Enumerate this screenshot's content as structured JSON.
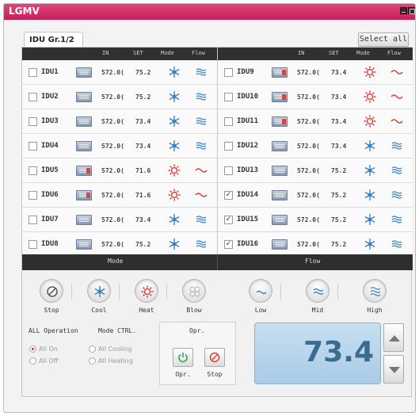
{
  "window": {
    "title": "LGMV"
  },
  "group_tab": "IDU Gr.1/2",
  "select_all": "Select all",
  "table_headers": [
    "IN",
    "SET",
    "Mode",
    "Flow"
  ],
  "left_rows": [
    {
      "name": "IDU1",
      "checked": false,
      "in": "572.0(",
      "set": "75.2",
      "mode": "cool",
      "flow": "wind",
      "unit": "cool"
    },
    {
      "name": "IDU2",
      "checked": false,
      "in": "572.0(",
      "set": "75.2",
      "mode": "cool",
      "flow": "wind",
      "unit": "cool"
    },
    {
      "name": "IDU3",
      "checked": false,
      "in": "572.0(",
      "set": "73.4",
      "mode": "cool",
      "flow": "wind",
      "unit": "cool"
    },
    {
      "name": "IDU4",
      "checked": false,
      "in": "572.0(",
      "set": "73.4",
      "mode": "cool",
      "flow": "wind",
      "unit": "cool"
    },
    {
      "name": "IDU5",
      "checked": false,
      "in": "572.0(",
      "set": "71.6",
      "mode": "heat",
      "flow": "wave",
      "unit": "heat"
    },
    {
      "name": "IDU6",
      "checked": false,
      "in": "572.0(",
      "set": "71.6",
      "mode": "heat",
      "flow": "wave",
      "unit": "heat"
    },
    {
      "name": "IDU7",
      "checked": false,
      "in": "572.0(",
      "set": "73.4",
      "mode": "cool",
      "flow": "wind",
      "unit": "cool"
    },
    {
      "name": "IDU8",
      "checked": false,
      "in": "572.0(",
      "set": "75.2",
      "mode": "cool",
      "flow": "wind",
      "unit": "cool"
    }
  ],
  "right_rows": [
    {
      "name": "IDU9",
      "checked": false,
      "in": "572.0(",
      "set": "73.4",
      "mode": "heat",
      "flow": "wave",
      "unit": "heat"
    },
    {
      "name": "IDU10",
      "checked": false,
      "in": "572.0(",
      "set": "73.4",
      "mode": "heat",
      "flow": "wave",
      "unit": "heat"
    },
    {
      "name": "IDU11",
      "checked": false,
      "in": "572.0(",
      "set": "73.4",
      "mode": "heat",
      "flow": "wave",
      "unit": "heat"
    },
    {
      "name": "IDU12",
      "checked": false,
      "in": "572.0(",
      "set": "73.4",
      "mode": "cool",
      "flow": "wind",
      "unit": "cool"
    },
    {
      "name": "IDU13",
      "checked": false,
      "in": "572.0(",
      "set": "75.2",
      "mode": "cool",
      "flow": "wind",
      "unit": "cool"
    },
    {
      "name": "IDU14",
      "checked": true,
      "in": "572.0(",
      "set": "75.2",
      "mode": "cool",
      "flow": "wind",
      "unit": "cool"
    },
    {
      "name": "IDU15",
      "checked": true,
      "in": "572.0(",
      "set": "75.2",
      "mode": "cool",
      "flow": "wind",
      "unit": "cool"
    },
    {
      "name": "IDU16",
      "checked": true,
      "in": "572.0(",
      "set": "75.2",
      "mode": "cool",
      "flow": "wind",
      "unit": "cool"
    }
  ],
  "mode_section": {
    "title": "Mode",
    "buttons": [
      "Stop",
      "Cool",
      "Heat",
      "Blow"
    ]
  },
  "flow_section": {
    "title": "Flow",
    "buttons": [
      "Low",
      "Mid",
      "High"
    ]
  },
  "all_operation": {
    "title": "ALL Operation",
    "options": [
      "All On",
      "All Off"
    ],
    "selected": "All On"
  },
  "mode_ctrl": {
    "title": "Mode CTRL.",
    "options": [
      "All Cooling",
      "All Heating"
    ]
  },
  "opr": {
    "title": "Opr.",
    "buttons": [
      "Opr.",
      "Stop"
    ]
  },
  "temperature": {
    "value": "73.4"
  },
  "colors": {
    "accent": "#c41f5a",
    "cool": "#3b82c4",
    "heat": "#e0413a"
  }
}
